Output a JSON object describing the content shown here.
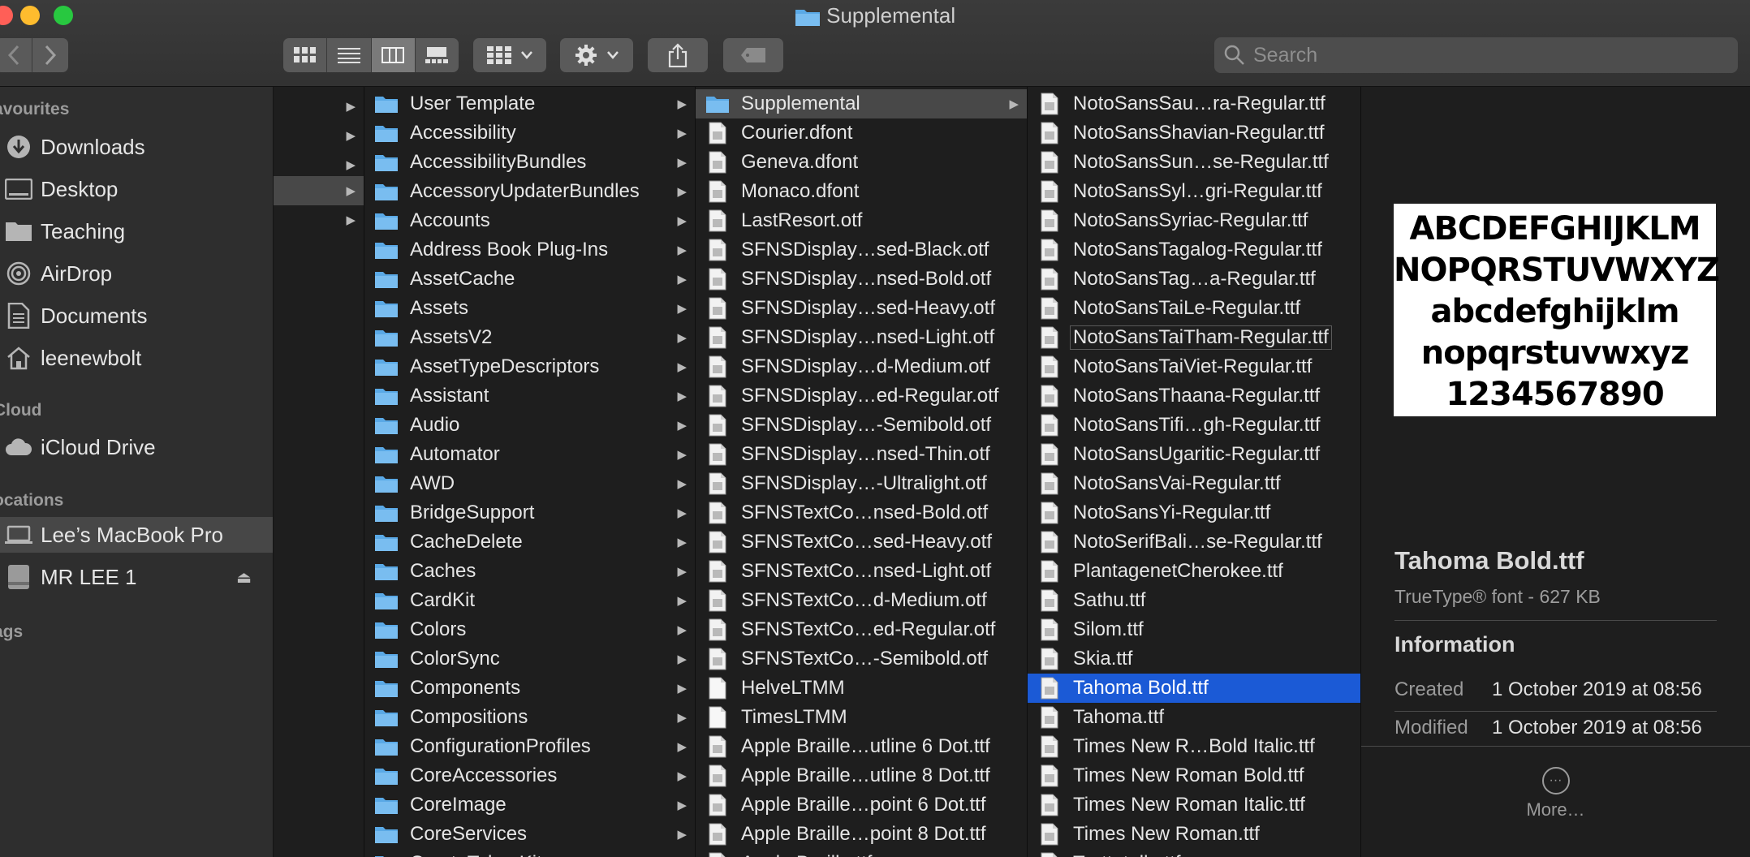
{
  "window": {
    "title": "Supplemental"
  },
  "toolbar": {
    "search_placeholder": "Search"
  },
  "sidebar": {
    "sections": [
      {
        "label": "avourites",
        "y": 0
      },
      {
        "label": "Cloud",
        "y": 1
      },
      {
        "label": "ocations",
        "y": 2
      },
      {
        "label": "ags",
        "y": 3
      }
    ],
    "favourites": [
      "Downloads",
      "Desktop",
      "Teaching",
      "AirDrop",
      "Documents",
      "leenewbolt"
    ],
    "icloud": [
      "iCloud Drive"
    ],
    "locations": [
      "Lee’s MacBook Pro",
      "MR LEE 1"
    ]
  },
  "column2": [
    "User Template",
    "Accessibility",
    "AccessibilityBundles",
    "AccessoryUpdaterBundles",
    "Accounts",
    "Address Book Plug-Ins",
    "AssetCache",
    "Assets",
    "AssetsV2",
    "AssetTypeDescriptors",
    "Assistant",
    "Audio",
    "Automator",
    "AWD",
    "BridgeSupport",
    "CacheDelete",
    "Caches",
    "CardKit",
    "Colors",
    "ColorSync",
    "Components",
    "Compositions",
    "ConfigurationProfiles",
    "CoreAccessories",
    "CoreImage",
    "CoreServices",
    "CryptoTokenKit"
  ],
  "column3": [
    "Supplemental",
    "Courier.dfont",
    "Geneva.dfont",
    "Monaco.dfont",
    "LastResort.otf",
    "SFNSDisplay…sed-Black.otf",
    "SFNSDisplay…nsed-Bold.otf",
    "SFNSDisplay…sed-Heavy.otf",
    "SFNSDisplay…nsed-Light.otf",
    "SFNSDisplay…d-Medium.otf",
    "SFNSDisplay…ed-Regular.otf",
    "SFNSDisplay…-Semibold.otf",
    "SFNSDisplay…nsed-Thin.otf",
    "SFNSDisplay…-Ultralight.otf",
    "SFNSTextCo…nsed-Bold.otf",
    "SFNSTextCo…sed-Heavy.otf",
    "SFNSTextCo…nsed-Light.otf",
    "SFNSTextCo…d-Medium.otf",
    "SFNSTextCo…ed-Regular.otf",
    "SFNSTextCo…-Semibold.otf",
    "HelveLTMM",
    "TimesLTMM",
    "Apple Braille…utline 6 Dot.ttf",
    "Apple Braille…utline 8 Dot.ttf",
    "Apple Braille…point 6 Dot.ttf",
    "Apple Braille…point 8 Dot.ttf",
    "Apple Braille.ttf"
  ],
  "column4": [
    "NotoSansSau…ra-Regular.ttf",
    "NotoSansShavian-Regular.ttf",
    "NotoSansSun…se-Regular.ttf",
    "NotoSansSyl…gri-Regular.ttf",
    "NotoSansSyriac-Regular.ttf",
    "NotoSansTagalog-Regular.ttf",
    "NotoSansTag…a-Regular.ttf",
    "NotoSansTaiLe-Regular.ttf",
    "NotoSansTaiTham-Regular.ttf",
    "NotoSansTaiViet-Regular.ttf",
    "NotoSansThaana-Regular.ttf",
    "NotoSansTifi…gh-Regular.ttf",
    "NotoSansUgaritic-Regular.ttf",
    "NotoSansVai-Regular.ttf",
    "NotoSansYi-Regular.ttf",
    "NotoSerifBali…se-Regular.ttf",
    "PlantagenetCherokee.ttf",
    "Sathu.ttf",
    "Silom.ttf",
    "Skia.ttf",
    "Tahoma Bold.ttf",
    "Tahoma.ttf",
    "Times New R…Bold Italic.ttf",
    "Times New Roman Bold.ttf",
    "Times New Roman Italic.ttf",
    "Times New Roman.ttf",
    "Trattatello.ttf"
  ],
  "preview": {
    "sample_lines": [
      "ABCDEFGHIJKLM",
      "NOPQRSTUVWXYZ",
      "abcdefghijklm",
      "nopqrstuvwxyz",
      "1234567890"
    ],
    "name": "Tahoma Bold.ttf",
    "kind": "TrueType® font - 627 KB",
    "info_heading": "Information",
    "created_label": "Created",
    "created_value": "1 October 2019 at 08:56",
    "modified_label": "Modified",
    "modified_value": "1 October 2019 at 08:56",
    "more_label": "More…"
  },
  "colors": {
    "selection_blue": "#1b5ad6",
    "folder_blue": "#5aa9e6"
  }
}
